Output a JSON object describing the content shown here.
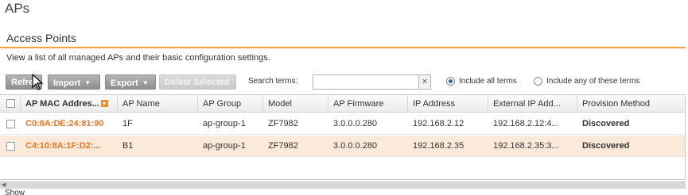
{
  "page": {
    "title": "APs"
  },
  "section": {
    "title": "Access Points",
    "description": "View a list of all managed APs and their basic configuration settings.",
    "accent_color": "#f7a23b"
  },
  "toolbar": {
    "refresh_label": "Refre",
    "import_label": "Import",
    "export_label": "Export",
    "delete_label": "Delete Selected",
    "search_label": "Search terms:",
    "search_value": "",
    "clear_label": "✕",
    "radio_all_label": "Include all terms",
    "radio_any_label": "Include any of these terms",
    "selected_radio": "all"
  },
  "table": {
    "columns": [
      "AP MAC Addres...",
      "AP Name",
      "AP Group",
      "Model",
      "AP Firmware",
      "IP Address",
      "External IP Add...",
      "Provision Method"
    ],
    "rows": [
      {
        "mac": "C0:8A:DE:24:81:90",
        "name": "1F",
        "group": "ap-group-1",
        "model": "ZF7982",
        "firmware": "3.0.0.0.280",
        "ip": "192.168.2.12",
        "ext_ip": "192.168.2.12:4...",
        "provision": "Discovered"
      },
      {
        "mac": "C4:10:8A:1F:D2:...",
        "name": "B1",
        "group": "ap-group-1",
        "model": "ZF7982",
        "firmware": "3.0.0.0.280",
        "ip": "192.168.2.35",
        "ext_ip": "192.168.2.35:3...",
        "provision": "Discovered"
      }
    ],
    "mac_color": "#e87722",
    "alt_row_color": "#fbe9d9"
  },
  "footer": {
    "show_label": "Show"
  }
}
